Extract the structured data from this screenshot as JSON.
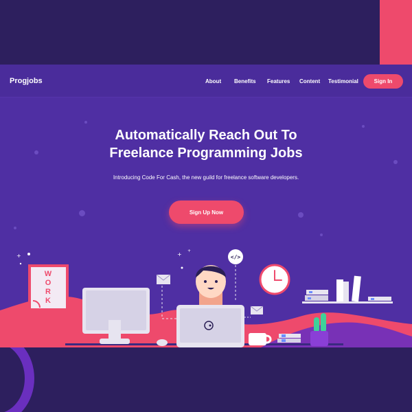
{
  "brand": {
    "name": "Progjobs"
  },
  "nav": {
    "links": [
      "About",
      "Benefits",
      "Features",
      "Content",
      "Testimonial"
    ],
    "signin_label": "Sign In"
  },
  "hero": {
    "headline_line1": "Automatically Reach Out To",
    "headline_line2": "Freelance Programming Jobs",
    "subheadline": "Introducing Code For Cash, the new guild for freelance software developers.",
    "cta_label": "Sign Up Now"
  },
  "illustration": {
    "poster_letters": [
      "W",
      "O",
      "R",
      "K"
    ],
    "code_bubble": "</>"
  },
  "colors": {
    "background": "#4f2fa3",
    "dark": "#2d1f5e",
    "accent": "#ee4a6c"
  }
}
